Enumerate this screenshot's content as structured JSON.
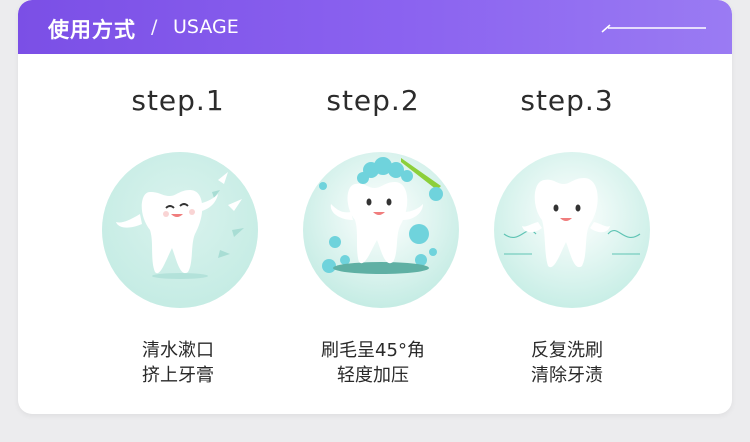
{
  "header": {
    "title": "使用方式",
    "separator": "/",
    "subtitle": "USAGE"
  },
  "steps": [
    {
      "title": "step.1",
      "caption_line1": "清水漱口",
      "caption_line2": "挤上牙膏",
      "illustration": "tooth-rinse-icon"
    },
    {
      "title": "step.2",
      "caption_line1": "刷毛呈45°角",
      "caption_line2": "轻度加压",
      "illustration": "tooth-brush-foam-icon"
    },
    {
      "title": "step.3",
      "caption_line1": "反复洗刷",
      "caption_line2": "清除牙渍",
      "illustration": "tooth-clean-icon"
    }
  ],
  "colors": {
    "header_start": "#7b4fe6",
    "header_end": "#9a7bf3",
    "illustration_bg": "#c5ece4",
    "accent_teal": "#5fc4b4",
    "bubble_blue": "#6fd3dc",
    "brush_green": "#8ccf3a"
  }
}
